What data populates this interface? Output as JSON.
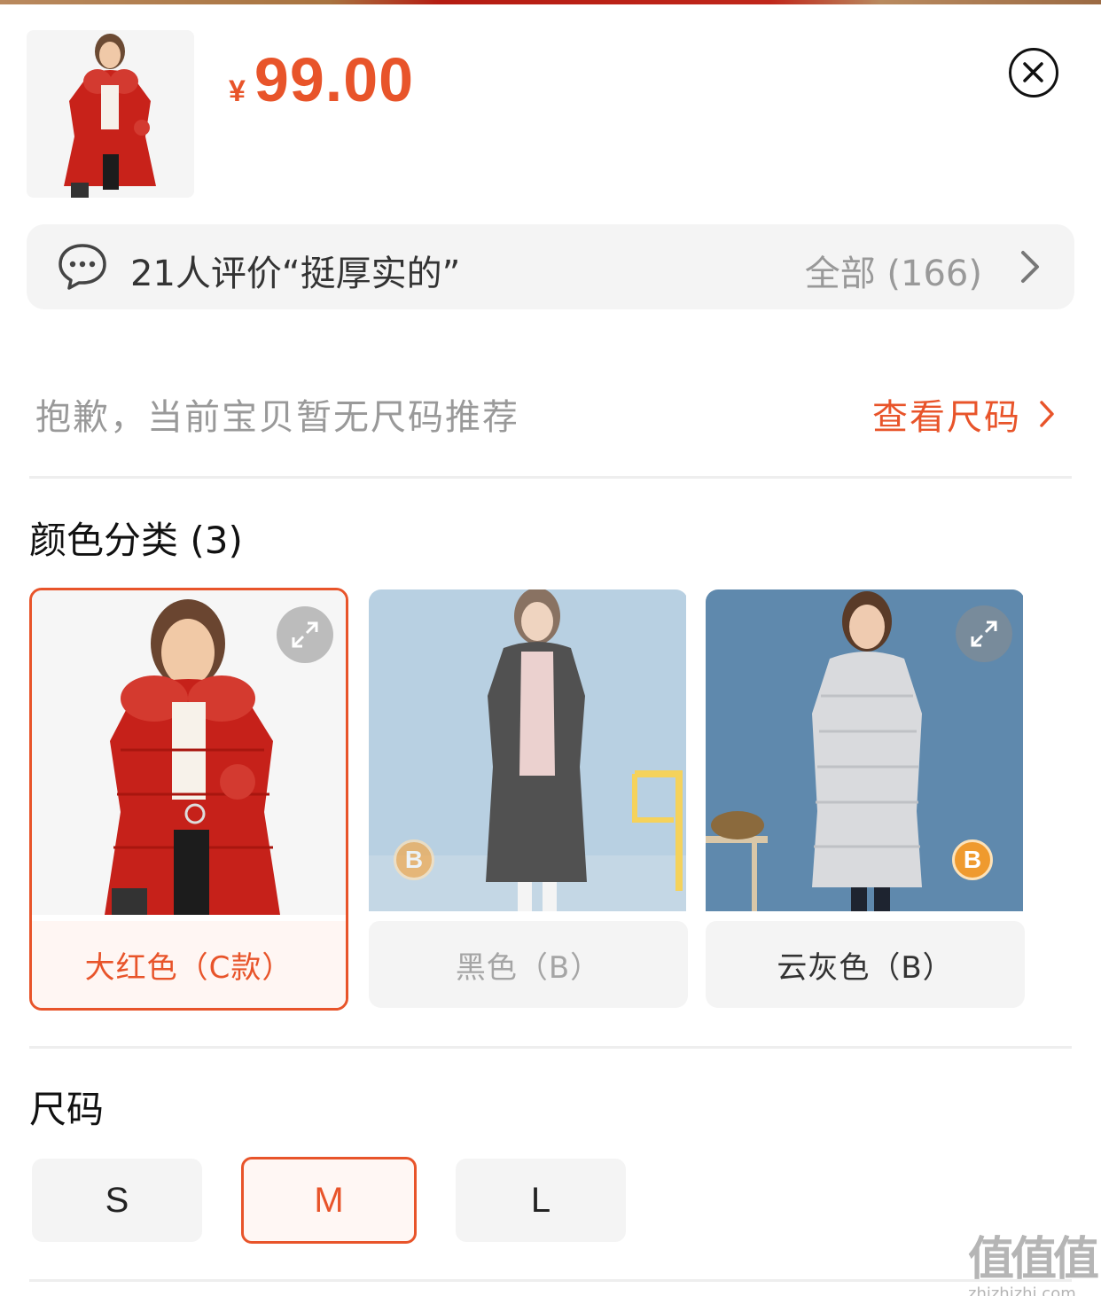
{
  "product": {
    "currency": "¥",
    "price": "99.00",
    "thumbnail": "red-down-coat-thumbnail"
  },
  "review": {
    "summary": "21人评价“挺厚实的”",
    "all_label": "全部 (166)"
  },
  "size_recommend": {
    "message": "抱歉，当前宝贝暂无尺码推荐",
    "guide_link": "查看尺码"
  },
  "colors": {
    "title": "颜色分类 (3)",
    "options": [
      {
        "label": "大红色（C款）",
        "state": "selected"
      },
      {
        "label": "黑色（B）",
        "state": "disabled"
      },
      {
        "label": "云灰色（B）",
        "state": "available"
      }
    ],
    "badge": "B"
  },
  "sizes": {
    "title": "尺码",
    "options": [
      {
        "label": "S",
        "state": "available"
      },
      {
        "label": "M",
        "state": "selected"
      },
      {
        "label": "L",
        "state": "available"
      }
    ]
  },
  "watermark": {
    "logo": "值值值",
    "url": "zhizhizhi.com"
  },
  "theme": {
    "accent": "#e8542a",
    "chip_bg": "#f4f4f4"
  }
}
